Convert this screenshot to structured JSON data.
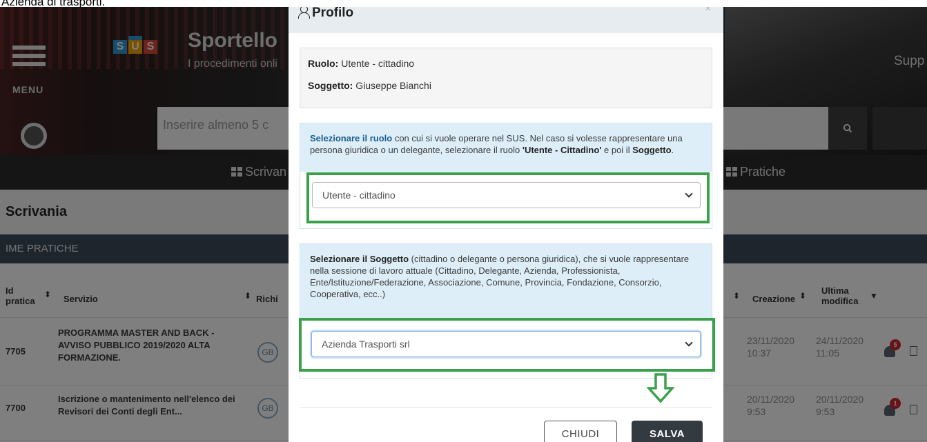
{
  "page_caption": "Azienda di trasporti.",
  "header": {
    "menu_label": "MENU",
    "logo_letters": [
      "S",
      "U",
      "S"
    ],
    "site_title": "Sportello",
    "site_subtitle": "I procedimenti onli",
    "right_link": "Supp",
    "search_placeholder": "Inserire almeno 5 c",
    "search_icon": "search-icon"
  },
  "nav": {
    "scrivania": "Scrivan",
    "pratiche": "Pratiche"
  },
  "page_title": "Scrivania",
  "table": {
    "section_label": "IME PRATICHE",
    "columns": {
      "id_line1": "Id",
      "id_line2": "pratica",
      "servizio": "Servizio",
      "richiedente": "Richi",
      "creazione": "Creazione",
      "ultima_line1": "Ultima",
      "ultima_line2": "modifica"
    },
    "rows": [
      {
        "id": "7705",
        "servizio": "PROGRAMMA MASTER AND BACK - AVVISO PUBBLICO 2019/2020 ALTA FORMAZIONE.",
        "avatar": "GB",
        "creazione_date": "23/11/2020",
        "creazione_time": "10:37",
        "modifica_date": "24/11/2020",
        "modifica_time": "11:05",
        "notifications": "5"
      },
      {
        "id": "7700",
        "servizio": "Iscrizione o mantenimento nell'elenco dei Revisori dei Conti degli Ent...",
        "avatar": "GB",
        "creazione_date": "20/11/2020",
        "creazione_time": "9:53",
        "modifica_date": "20/11/2020",
        "modifica_time": "9:53",
        "notifications": "1"
      }
    ]
  },
  "modal": {
    "title": "Profilo",
    "close_glyph": "×",
    "ruolo_label": "Ruolo:",
    "ruolo_value": "Utente - cittadino",
    "soggetto_label": "Soggetto:",
    "soggetto_value": "Giuseppe Bianchi",
    "role_help_bold": "Selezionare il ruolo",
    "role_help_text": " con cui si vuole operare nel SUS. Nel caso si volesse rappresentare una persona giuridica o un delegante, selezionare il ruolo ",
    "role_help_bold2": "'Utente - Cittadino'",
    "role_help_text2": " e poi il ",
    "role_help_bold3": "Soggetto",
    "role_help_text3": ".",
    "role_select_value": "Utente - cittadino",
    "subject_help_bold": "Selezionare il Soggetto",
    "subject_help_text": " (cittadino o delegante o persona giuridica), che si vuole rappresentare nella sessione di lavoro attuale (Cittadino, Delegante, Azienda, Professionista, Ente/Istituzione/Federazione, Associazione, Comune, Provincia, Fondazione, Consorzio, Cooperativa, ecc..)",
    "subject_select_value": "Azienda Trasporti srl",
    "btn_close": "CHIUDI",
    "btn_save": "SALVA"
  },
  "colors": {
    "highlight": "#3aa04a",
    "save_button": "#333a40",
    "panel_bg": "#deeef8"
  }
}
